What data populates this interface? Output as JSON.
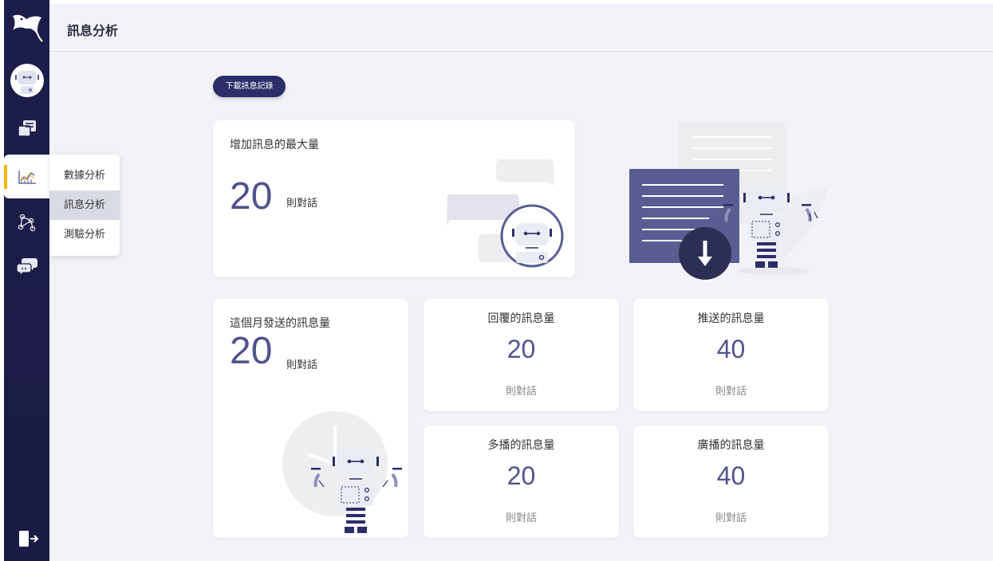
{
  "app": {
    "page_title": "訊息分析"
  },
  "sidebar": {
    "nav": [
      {
        "icon": "robot-avatar-icon"
      },
      {
        "icon": "messages-icon"
      },
      {
        "icon": "chart-icon",
        "active": true
      },
      {
        "icon": "network-icon"
      },
      {
        "icon": "chat-bubbles-icon"
      }
    ],
    "exit_icon": "logout-icon",
    "accent_color": "#f4b400"
  },
  "submenu": {
    "items": [
      {
        "label": "數據分析"
      },
      {
        "label": "訊息分析",
        "active": true
      },
      {
        "label": "測驗分析"
      }
    ]
  },
  "toolbar": {
    "download_label": "下載訊息記錄"
  },
  "max_card": {
    "title": "增加訊息的最大量",
    "value": "20",
    "unit": "則對話"
  },
  "month_card": {
    "title": "這個月發送的訊息量",
    "value": "20",
    "unit": "則對話"
  },
  "stats": [
    {
      "title": "回覆的訊息量",
      "value": "20",
      "unit": "則對話"
    },
    {
      "title": "推送的訊息量",
      "value": "40",
      "unit": "則對話"
    },
    {
      "title": "多播的訊息量",
      "value": "20",
      "unit": "則對話"
    },
    {
      "title": "廣播的訊息量",
      "value": "40",
      "unit": "則對話"
    }
  ],
  "colors": {
    "sidebar": "#1c1d4a",
    "primary": "#52538c",
    "button": "#2c2e6a"
  }
}
